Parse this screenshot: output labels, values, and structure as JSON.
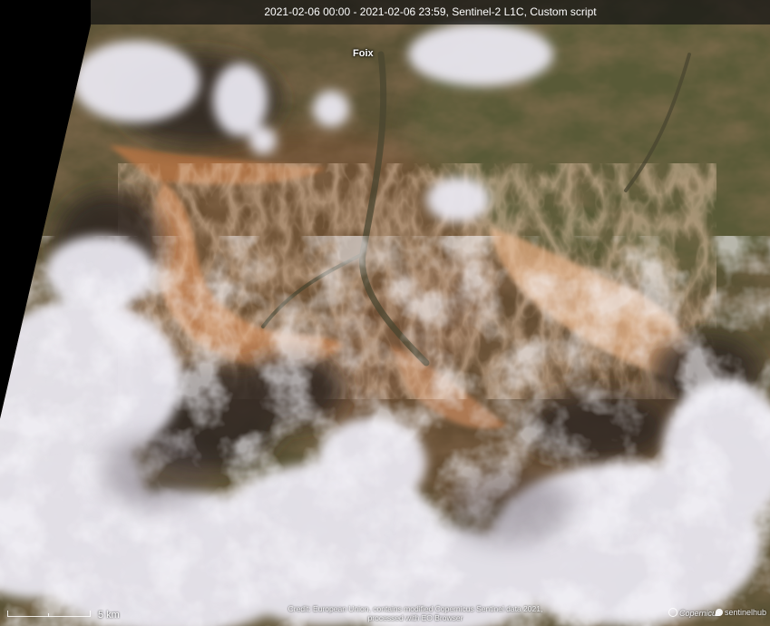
{
  "header": {
    "title": "2021-02-06 00:00 - 2021-02-06 23:59, Sentinel-2 L1C, Custom script"
  },
  "map": {
    "place_labels": [
      {
        "name": "Foix"
      }
    ],
    "scale": {
      "label": "5 km"
    },
    "credit": {
      "line1": "Credit: European Union, contains modified Copernicus Sentinel data 2021,",
      "line2": "processed with EO Browser"
    },
    "logos": {
      "copernicus": "Copernicus",
      "sentinelhub": "sentinelhub"
    },
    "colors": {
      "terrain_brown": "#7a5a3c",
      "terrain_green": "#5c5a3a",
      "sunlit_ridge": "#d9a277",
      "cloud": "#e8e6ee",
      "shadow": "#2e2722",
      "nodata": "#000000"
    }
  }
}
